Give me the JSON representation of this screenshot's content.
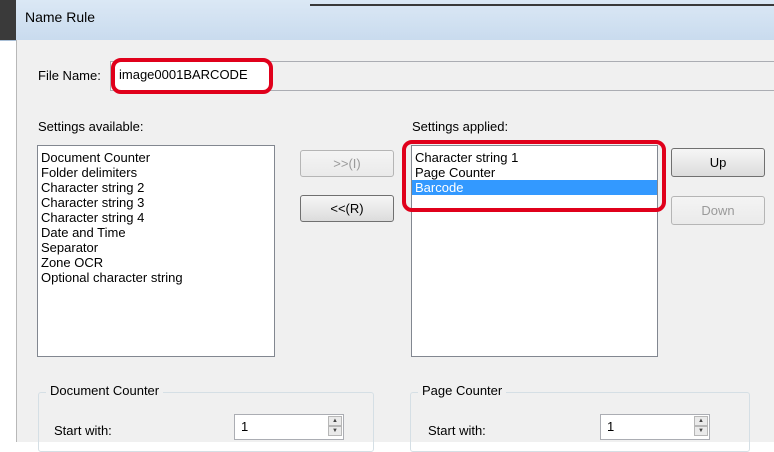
{
  "window": {
    "title": "Name Rule"
  },
  "file_name": {
    "label": "File Name:",
    "value": "image0001BARCODE"
  },
  "settings_available": {
    "label": "Settings available:",
    "items": [
      "Document Counter",
      "Folder delimiters",
      "Character string 2",
      "Character string 3",
      "Character string 4",
      "Date and Time",
      "Separator",
      "Zone OCR",
      "Optional character string"
    ]
  },
  "settings_applied": {
    "label": "Settings applied:",
    "items": [
      "Character string 1",
      "Page Counter",
      "Barcode"
    ],
    "selected_index": 2
  },
  "buttons": {
    "add": ">>(I)",
    "remove": "<<(R)",
    "up": "Up",
    "down": "Down"
  },
  "document_counter": {
    "title": "Document Counter",
    "start_label": "Start with:",
    "start_value": "1"
  },
  "page_counter": {
    "title": "Page Counter",
    "start_label": "Start with:",
    "start_value": "1"
  },
  "highlight_color": "#e0001b"
}
